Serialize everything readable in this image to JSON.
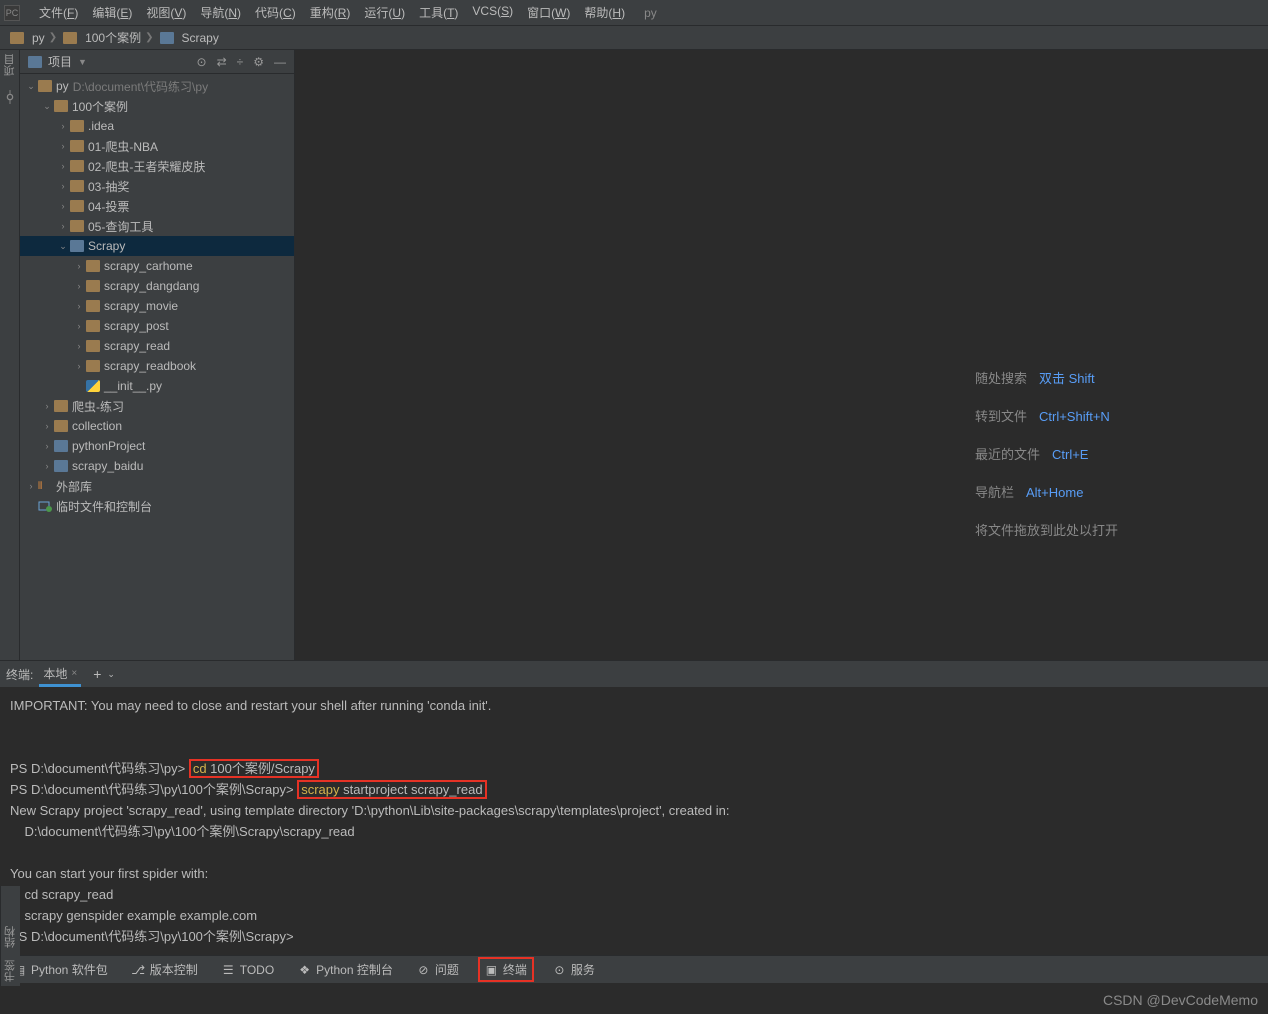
{
  "menubar": {
    "items": [
      "文件(F)",
      "编辑(E)",
      "视图(V)",
      "导航(N)",
      "代码(C)",
      "重构(R)",
      "运行(U)",
      "工具(T)",
      "VCS(S)",
      "窗口(W)",
      "帮助(H)"
    ],
    "run_config": "py"
  },
  "breadcrumbs": [
    "py",
    "100个案例",
    "Scrapy"
  ],
  "left_stripe": [
    "项目"
  ],
  "project_panel": {
    "title": "项目",
    "tree": [
      {
        "depth": 0,
        "chev": "down",
        "icon": "folder",
        "label": "py",
        "path": "D:\\document\\代码练习\\py"
      },
      {
        "depth": 1,
        "chev": "down",
        "icon": "folder",
        "label": "100个案例"
      },
      {
        "depth": 2,
        "chev": "right",
        "icon": "folder",
        "label": ".idea"
      },
      {
        "depth": 2,
        "chev": "right",
        "icon": "folder",
        "label": "01-爬虫-NBA"
      },
      {
        "depth": 2,
        "chev": "right",
        "icon": "folder",
        "label": "02-爬虫-王者荣耀皮肤"
      },
      {
        "depth": 2,
        "chev": "right",
        "icon": "folder",
        "label": "03-抽奖"
      },
      {
        "depth": 2,
        "chev": "right",
        "icon": "folder",
        "label": "04-投票"
      },
      {
        "depth": 2,
        "chev": "right",
        "icon": "folder",
        "label": "05-查询工具"
      },
      {
        "depth": 2,
        "chev": "down",
        "icon": "folder-b",
        "label": "Scrapy",
        "selected": true
      },
      {
        "depth": 3,
        "chev": "right",
        "icon": "folder",
        "label": "scrapy_carhome"
      },
      {
        "depth": 3,
        "chev": "right",
        "icon": "folder",
        "label": "scrapy_dangdang"
      },
      {
        "depth": 3,
        "chev": "right",
        "icon": "folder",
        "label": "scrapy_movie"
      },
      {
        "depth": 3,
        "chev": "right",
        "icon": "folder",
        "label": "scrapy_post"
      },
      {
        "depth": 3,
        "chev": "right",
        "icon": "folder",
        "label": "scrapy_read"
      },
      {
        "depth": 3,
        "chev": "right",
        "icon": "folder",
        "label": "scrapy_readbook"
      },
      {
        "depth": 3,
        "chev": "none",
        "icon": "py",
        "label": "__init__.py"
      },
      {
        "depth": 1,
        "chev": "right",
        "icon": "folder",
        "label": "爬虫-练习"
      },
      {
        "depth": 1,
        "chev": "right",
        "icon": "folder",
        "label": "collection"
      },
      {
        "depth": 1,
        "chev": "right",
        "icon": "folder-b",
        "label": "pythonProject"
      },
      {
        "depth": 1,
        "chev": "right",
        "icon": "folder-b",
        "label": "scrapy_baidu"
      },
      {
        "depth": 0,
        "chev": "right",
        "icon": "lib",
        "label": "外部库"
      },
      {
        "depth": 0,
        "chev": "none",
        "icon": "scratch",
        "label": "临时文件和控制台"
      }
    ]
  },
  "editor_hints": [
    {
      "label": "随处搜索",
      "key": "双击 Shift"
    },
    {
      "label": "转到文件",
      "key": "Ctrl+Shift+N"
    },
    {
      "label": "最近的文件",
      "key": "Ctrl+E"
    },
    {
      "label": "导航栏",
      "key": "Alt+Home"
    },
    {
      "label": "将文件拖放到此处以打开",
      "key": ""
    }
  ],
  "terminal": {
    "tab_label": "终端:",
    "tab_name": "本地",
    "lines": [
      {
        "t": "IMPORTANT: You may need to close and restart your shell after running 'conda init'."
      },
      {
        "t": ""
      },
      {
        "t": ""
      },
      {
        "prompt": "PS D:\\document\\代码练习\\py> ",
        "hl": "cd 100个案例/Scrapy"
      },
      {
        "prompt": "PS D:\\document\\代码练习\\py\\100个案例\\Scrapy> ",
        "hl": "scrapy startproject scrapy_read"
      },
      {
        "t": "New Scrapy project 'scrapy_read', using template directory 'D:\\python\\Lib\\site-packages\\scrapy\\templates\\project', created in:"
      },
      {
        "t": "    D:\\document\\代码练习\\py\\100个案例\\Scrapy\\scrapy_read"
      },
      {
        "t": ""
      },
      {
        "t": "You can start your first spider with:"
      },
      {
        "t": "    cd scrapy_read"
      },
      {
        "t": "    scrapy genspider example example.com"
      },
      {
        "prompt": "PS D:\\document\\代码练习\\py\\100个案例\\Scrapy>",
        "t": ""
      }
    ]
  },
  "bottom_bar": {
    "items": [
      {
        "icon": "pkg",
        "label": "Python 软件包"
      },
      {
        "icon": "vcs",
        "label": "版本控制"
      },
      {
        "icon": "todo",
        "label": "TODO"
      },
      {
        "icon": "pyc",
        "label": "Python 控制台"
      },
      {
        "icon": "prob",
        "label": "问题"
      },
      {
        "icon": "term",
        "label": "终端",
        "hl": true
      },
      {
        "icon": "svc",
        "label": "服务"
      }
    ]
  },
  "left_bottom_stripe": [
    "书签",
    "结构"
  ],
  "watermark": "CSDN @DevCodeMemo"
}
